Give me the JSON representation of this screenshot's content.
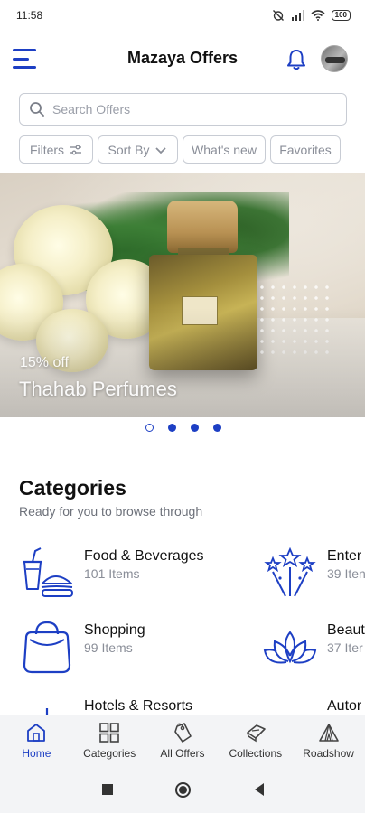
{
  "status_bar": {
    "time": "11:58",
    "battery": "100"
  },
  "header": {
    "title": "Mazaya Offers"
  },
  "search": {
    "placeholder": "Search Offers"
  },
  "filters": {
    "filters_label": "Filters",
    "sort_label": "Sort By",
    "whats_new_label": "What's new",
    "favorites_label": "Favorites"
  },
  "banner": {
    "discount": "15% off",
    "brand": "Thahab Perfumes",
    "slide_count": 4,
    "active_slides": [
      false,
      true,
      true,
      true
    ]
  },
  "categories": {
    "title": "Categories",
    "subtitle": "Ready for you to browse through",
    "items": [
      {
        "name": "Food & Beverages",
        "count": "101 Items",
        "icon": "food-beverages-icon"
      },
      {
        "name": "Enter",
        "count": "39 Iten",
        "icon": "entertainment-icon"
      },
      {
        "name": "Shopping",
        "count": "99 Items",
        "icon": "shopping-bag-icon"
      },
      {
        "name": "Beaut",
        "count": "37 Iter",
        "icon": "lotus-icon"
      },
      {
        "name": "Hotels & Resorts",
        "count": "",
        "icon": "hotel-icon"
      },
      {
        "name": "Autor",
        "count": "",
        "icon": "automotive-icon"
      }
    ]
  },
  "bottom_nav": {
    "items": [
      {
        "label": "Home",
        "icon": "home-icon",
        "active": true
      },
      {
        "label": "Categories",
        "icon": "grid-icon",
        "active": false
      },
      {
        "label": "All Offers",
        "icon": "tag-icon",
        "active": false
      },
      {
        "label": "Collections",
        "icon": "collections-icon",
        "active": false
      },
      {
        "label": "Roadshow",
        "icon": "tent-icon",
        "active": false
      }
    ]
  },
  "colors": {
    "accent": "#1d3fc4",
    "muted_text": "#8a8e98",
    "border": "#c8ccd4"
  }
}
